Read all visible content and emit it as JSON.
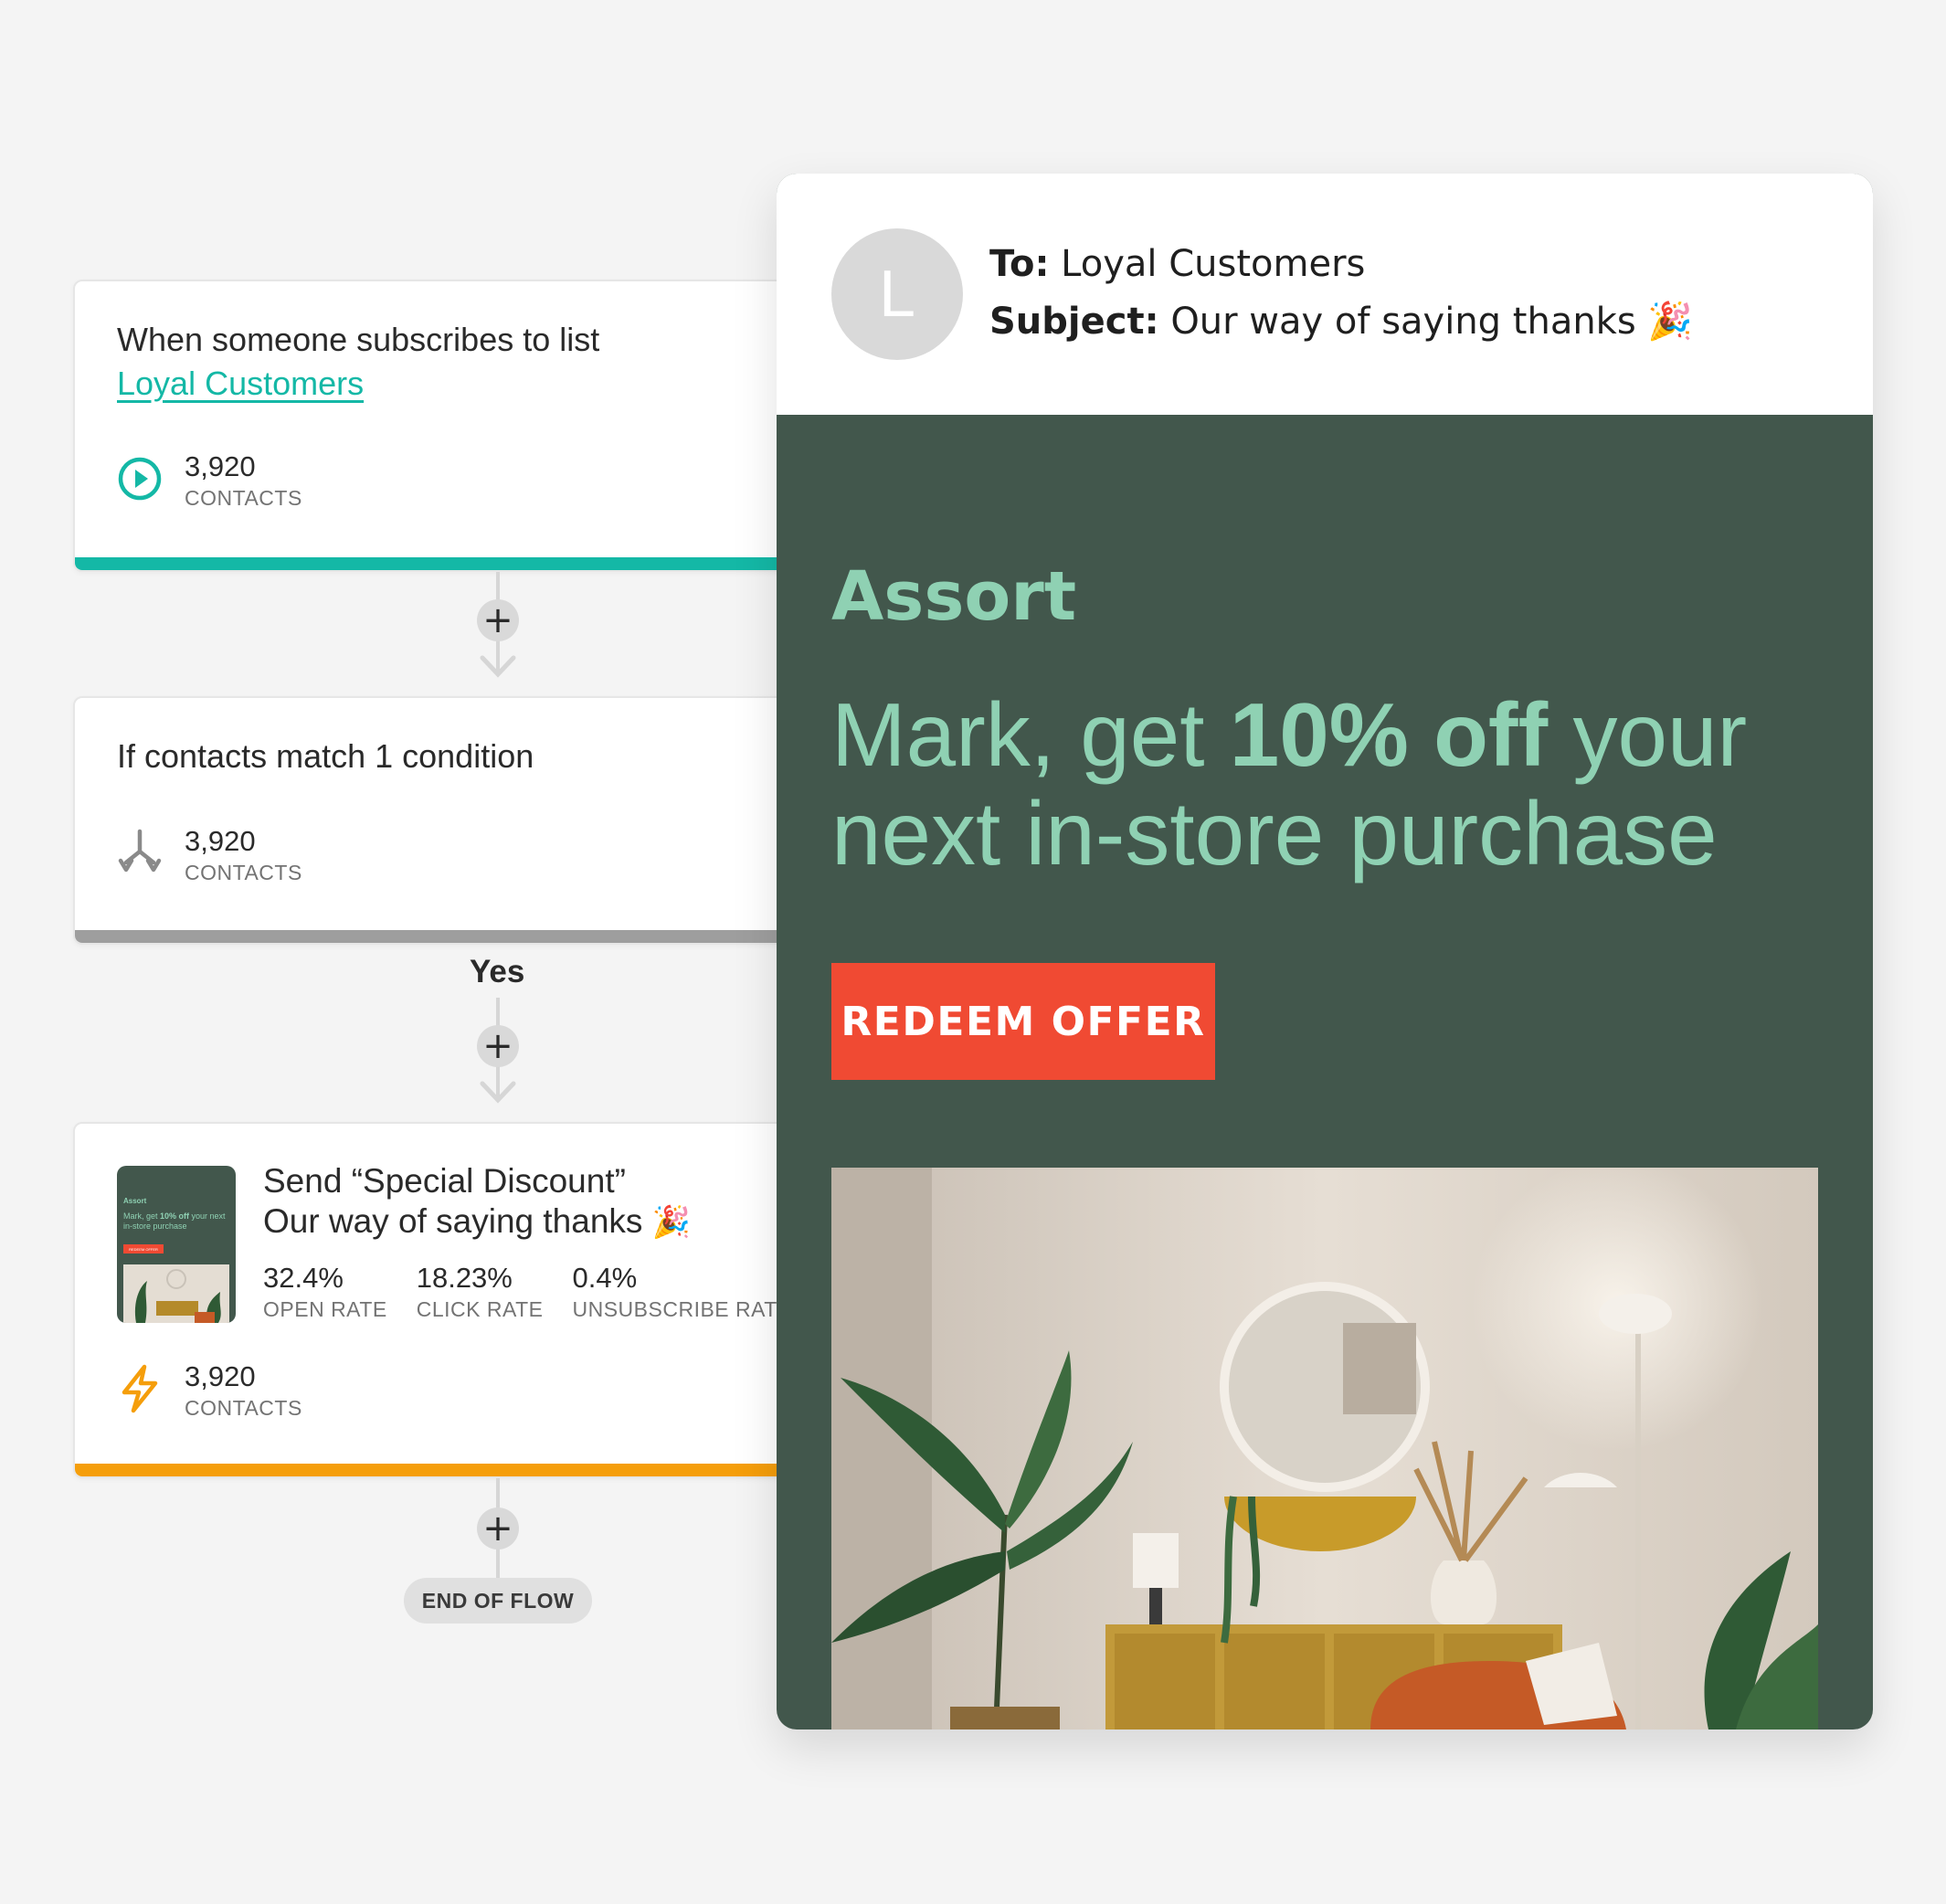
{
  "flow": {
    "trigger": {
      "title": "When someone subscribes to list",
      "list_name": "Loyal Customers",
      "count": "3,920",
      "count_label": "CONTACTS"
    },
    "condition": {
      "title": "If contacts match 1 condition",
      "count": "3,920",
      "count_label": "CONTACTS"
    },
    "branch_label": "Yes",
    "send": {
      "title": "Send “Special Discount”",
      "subtitle": "Our way of saying thanks",
      "emoji": "🎉",
      "metrics": [
        {
          "value": "32.4%",
          "label": "OPEN RATE"
        },
        {
          "value": "18.23%",
          "label": "CLICK RATE"
        },
        {
          "value": "0.4%",
          "label": "UNSUBSCRIBE RATE"
        }
      ],
      "count": "3,920",
      "count_label": "CONTACTS",
      "thumb": {
        "brand": "Assort",
        "headline_pre": "Mark, get ",
        "headline_strong": "10% off",
        "headline_post": " your next in-store purchase",
        "cta": "REDEEM OFFER"
      }
    },
    "plus_symbol": "+",
    "end_label": "END OF FLOW"
  },
  "email": {
    "avatar_letter": "L",
    "to_label": "To:",
    "to_value": "Loyal Customers",
    "subject_label": "Subject:",
    "subject_value": "Our way of saying thanks",
    "subject_emoji": "🎉",
    "brand": "Assort",
    "headline_pre": "Mark, get ",
    "headline_strong": "10% off",
    "headline_post": " your next in-store purchase",
    "cta_label": "REDEEM OFFER"
  },
  "colors": {
    "teal": "#14b8a6",
    "gray_bar": "#9e9e9e",
    "orange_bar": "#f59e0b",
    "email_bg": "#42574c",
    "email_text": "#8fd1b3",
    "cta_red": "#f04a33"
  },
  "icons": {
    "trigger": "play-circle-icon",
    "condition": "split-arrows-icon",
    "send": "lightning-icon"
  }
}
